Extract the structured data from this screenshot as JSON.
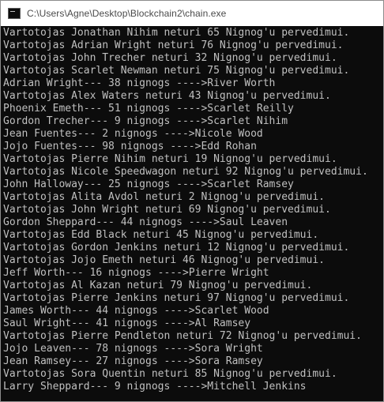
{
  "window": {
    "title": "C:\\Users\\Agne\\Desktop\\Blockchain2\\chain.exe",
    "icon": "console-app-icon"
  },
  "console": {
    "lines": [
      "Vartotojas Jonathan Nihim neturi 65 Nignog'u pervedimui.",
      "Vartotojas Adrian Wright neturi 76 Nignog'u pervedimui.",
      "Vartotojas John Trecher neturi 32 Nignog'u pervedimui.",
      "Vartotojas Scarlet Newman neturi 75 Nignog'u pervedimui.",
      "Adrian Wright--- 38 nignogs ---->River Worth",
      "Vartotojas Alex Waters neturi 43 Nignog'u pervedimui.",
      "Phoenix Emeth--- 51 nignogs ---->Scarlet Reilly",
      "Gordon Trecher--- 9 nignogs ---->Scarlet Nihim",
      "Jean Fuentes--- 2 nignogs ---->Nicole Wood",
      "Jojo Fuentes--- 98 nignogs ---->Edd Rohan",
      "Vartotojas Pierre Nihim neturi 19 Nignog'u pervedimui.",
      "Vartotojas Nicole Speedwagon neturi 92 Nignog'u pervedimui.",
      "John Halloway--- 25 nignogs ---->Scarlet Ramsey",
      "Vartotojas Alita Avdol neturi 2 Nignog'u pervedimui.",
      "Vartotojas John Wright neturi 69 Nignog'u pervedimui.",
      "Gordon Sheppard--- 44 nignogs ---->Saul Leaven",
      "Vartotojas Edd Black neturi 45 Nignog'u pervedimui.",
      "Vartotojas Gordon Jenkins neturi 12 Nignog'u pervedimui.",
      "Vartotojas Jojo Emeth neturi 46 Nignog'u pervedimui.",
      "Jeff Worth--- 16 nignogs ---->Pierre Wright",
      "Vartotojas Al Kazan neturi 79 Nignog'u pervedimui.",
      "Vartotojas Pierre Jenkins neturi 97 Nignog'u pervedimui.",
      "James Worth--- 44 nignogs ---->Scarlet Wood",
      "Saul Wright--- 41 nignogs ---->Al Ramsey",
      "Vartotojas Pierre Pendleton neturi 72 Nignog'u pervedimui.",
      "Jojo Leaven--- 78 nignogs ---->Sora Wright",
      "Jean Ramsey--- 27 nignogs ---->Sora Ramsey",
      "Vartotojas Sora Quentin neturi 85 Nignog'u pervedimui.",
      "Larry Sheppard--- 9 nignogs ---->Mitchell Jenkins"
    ]
  },
  "colors": {
    "console_bg": "#0c0c0c",
    "console_fg": "#c0c0c0",
    "titlebar_bg": "#ffffff",
    "title_fg": "#4a4a4a"
  }
}
